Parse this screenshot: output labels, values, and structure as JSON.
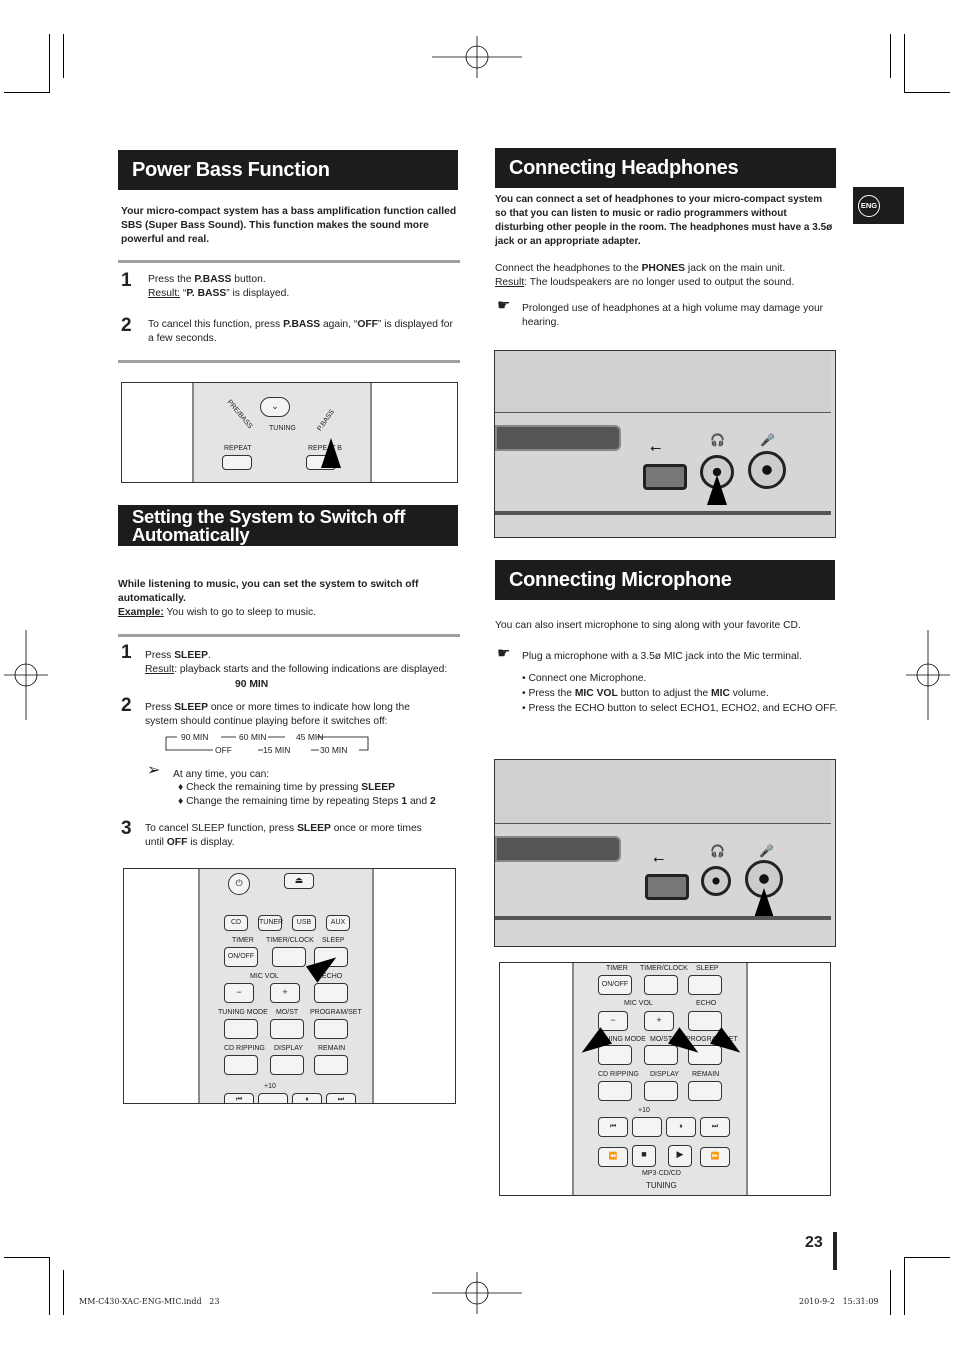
{
  "power_bass": {
    "title": "Power Bass Function",
    "intro": "Your micro-compact system has a bass amplification function called SBS (Super Bass Sound). This function makes the sound more powerful and real.",
    "steps": [
      {
        "num": "1",
        "pre": "Press the ",
        "bold": "P.BASS",
        "post": " button.",
        "result_label": "Result:",
        "result_pre": " “",
        "result_bold": "P. BASS",
        "result_post": "” is displayed."
      },
      {
        "num": "2",
        "pre": "To cancel this function, press ",
        "bold": "P.BASS",
        "mid": " again, “",
        "bold2": "OFF",
        "post": "” is displayed  for a few seconds."
      }
    ],
    "remote_labels": [
      "PRE/BASS",
      "TUNING",
      "P.BASS",
      "REPEAT",
      "REPEAT B"
    ]
  },
  "sleep": {
    "title_line1": "Setting the System to Switch off",
    "title_line2": "Automatically",
    "intro": "While listening to music, you can set the system to switch off automatically.",
    "example_label": "Example:",
    "example_text": " You wish to go to sleep to music.",
    "step1": {
      "num": "1",
      "pre": "Press ",
      "bold": "SLEEP",
      "post": ".",
      "result_label": "Result",
      "result_text": ": playback starts and the following indications are displayed:",
      "display": "90 MIN"
    },
    "step2": {
      "num": "2",
      "pre": "Press ",
      "bold": "SLEEP",
      "post": " once or more times to indicate how long the system should continue playing before it switches off:"
    },
    "cycle": [
      "90 MIN",
      "60 MIN",
      "45 MIN",
      "30 MIN",
      "15 MIN",
      "OFF"
    ],
    "tip_intro": "At any time, you can:",
    "tip1_pre": "Check the remaining time by pressing ",
    "tip1_bold": "SLEEP",
    "tip2_pre": "Change the remaining time by repeating Steps ",
    "tip2_b1": "1",
    "tip2_mid": " and ",
    "tip2_b2": "2",
    "step3": {
      "num": "3",
      "pre": "To cancel SLEEP function, press ",
      "bold": "SLEEP",
      "mid": " once or more times until  ",
      "bold2": "OFF",
      "post": " is display."
    },
    "remote_buttons": [
      "CD",
      "TUNER",
      "USB",
      "AUX"
    ],
    "remote_labels": [
      "TIMER",
      "TIMER/CLOCK",
      "SLEEP",
      "ON/OFF",
      "MIC VOL",
      "ECHO",
      "TUNING MODE",
      "MO/ST",
      "PROGRAM/SET",
      "CD RIPPING",
      "DISPLAY",
      "REMAIN",
      "+10"
    ]
  },
  "headphones": {
    "title": "Connecting Headphones",
    "intro": "You can connect a set of headphones to your micro-compact system so that you can listen to music or radio programmers without disturbing other people in the room. The headphones must have a 3.5ø jack or an appropriate adapter.",
    "connect_pre": "Connect the headphones to the ",
    "connect_bold": "PHONES",
    "connect_post": " jack on the main unit.",
    "result_label": "Result",
    "result_text": ": The loudspeakers are no longer used to output the sound.",
    "note": "Prolonged use of headphones at a high volume may damage your hearing."
  },
  "microphone": {
    "title": "Connecting Microphone",
    "intro": "You can also insert microphone to sing along with your favorite CD.",
    "note": "Plug a microphone with a 3.5ø MIC jack into the Mic terminal.",
    "bullets": {
      "b1": "Connect one Microphone.",
      "b2_pre": "Press the ",
      "b2_bold": "MIC VOL",
      "b2_mid": " button to adjust the ",
      "b2_bold2": "MIC",
      "b2_post": " volume.",
      "b3": "Press the ECHO button to select ECHO1, ECHO2, and ECHO OFF."
    },
    "remote_labels": [
      "TIMER",
      "TIMER/CLOCK",
      "SLEEP",
      "ON/OFF",
      "MIC VOL",
      "ECHO",
      "TUNING MODE",
      "MO/ST",
      "PROGRAM/SET",
      "CD RIPPING",
      "DISPLAY",
      "REMAIN",
      "+10",
      "MP3·CD/CD",
      "TUNING"
    ]
  },
  "lang_tab": "ENG",
  "page_number": "23",
  "footer": {
    "left": "MM-C430-XAC-ENG-MIC.indd   23",
    "right": "2010-9-2   15:31:09"
  }
}
